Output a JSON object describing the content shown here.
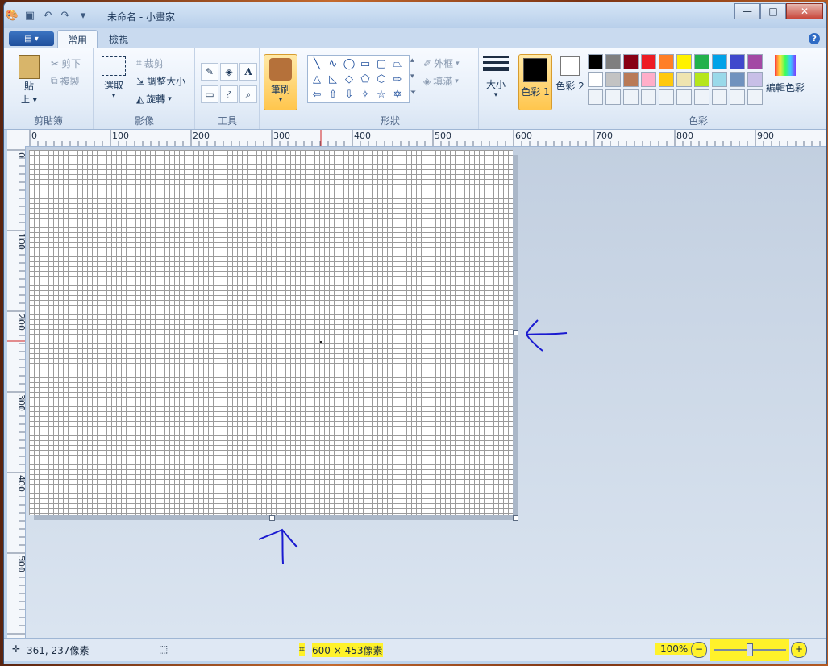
{
  "window": {
    "title": "未命名 - 小畫家"
  },
  "tabs": {
    "home": "常用",
    "view": "檢視"
  },
  "clipboard": {
    "paste": "貼",
    "paste_sub": "上",
    "cut": "剪下",
    "copy": "複製",
    "label": "剪貼簿"
  },
  "image": {
    "select": "選取",
    "crop": "裁剪",
    "resize": "調整大小",
    "rotate": "旋轉",
    "label": "影像"
  },
  "tools": {
    "label": "工具",
    "text_tool": "A"
  },
  "brushes": {
    "label": "筆刷"
  },
  "shapes": {
    "outline": "外框",
    "fill": "填滿",
    "label": "形狀"
  },
  "size": {
    "label": "大小"
  },
  "colors": {
    "color1": "色彩 1",
    "color2": "色彩 2",
    "edit": "編輯色彩",
    "label": "色彩",
    "color1_value": "#000000",
    "color2_value": "#ffffff",
    "palette_row1": [
      "#000000",
      "#7f7f7f",
      "#880015",
      "#ed1c24",
      "#ff7f27",
      "#fff200",
      "#22b14c",
      "#00a2e8",
      "#3f48cc",
      "#a349a4"
    ],
    "palette_row2": [
      "#ffffff",
      "#c3c3c3",
      "#b97a57",
      "#ffaec9",
      "#ffc90e",
      "#efe4b0",
      "#b5e61d",
      "#99d9ea",
      "#7092be",
      "#c8bfe7"
    ]
  },
  "ruler": {
    "h_ticks": [
      "0",
      "100",
      "200",
      "300",
      "400",
      "500",
      "600",
      "700",
      "800",
      "900"
    ],
    "v_ticks": [
      "0",
      "100",
      "200",
      "300",
      "400",
      "500"
    ]
  },
  "status": {
    "cursor": "361, 237像素",
    "size": "600 × 453像素",
    "zoom": "100%"
  }
}
